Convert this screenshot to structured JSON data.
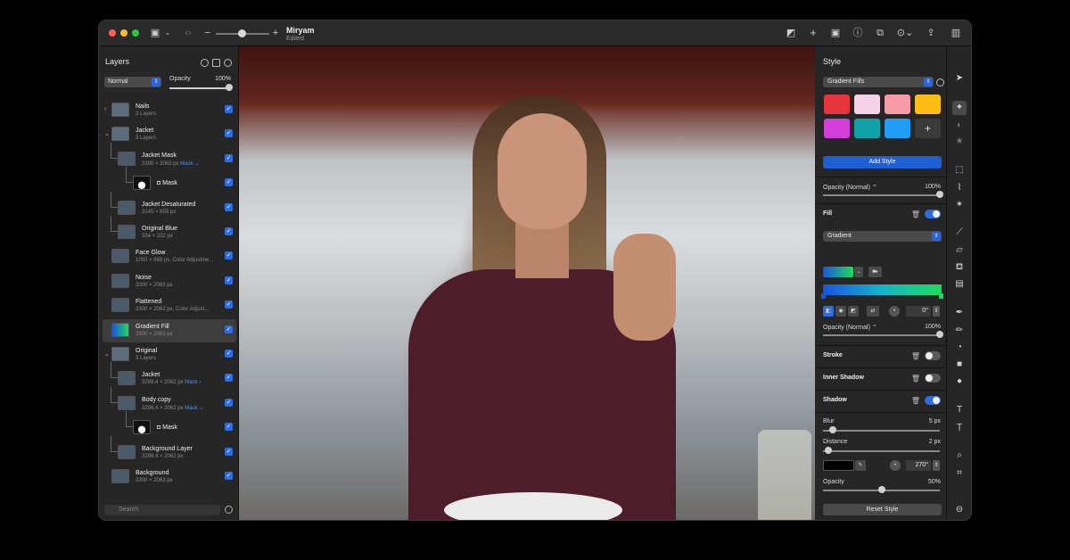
{
  "app": {
    "doc_title": "Miryam",
    "doc_status": "Edited"
  },
  "layers_panel": {
    "title": "Layers",
    "blend_mode": "Normal",
    "opacity_label": "Opacity",
    "opacity_value": "100%",
    "opacity_fraction": 1.0,
    "search_placeholder": "Search",
    "items": [
      {
        "name": "Nails",
        "detail": "3 Layers",
        "type": "group",
        "expanded": false
      },
      {
        "name": "Jacket",
        "detail": "3 Layers",
        "type": "group",
        "expanded": true
      },
      {
        "name": "Jacket Mask",
        "detail": "3300 × 2063 px",
        "mask": "Mask ⌄",
        "type": "image"
      },
      {
        "name": "Mask",
        "detail": "",
        "type": "mask"
      },
      {
        "name": "Jacket Desaturated",
        "detail": "3145 × 855 px",
        "type": "image"
      },
      {
        "name": "Original Blue",
        "detail": "334 × 232 px",
        "type": "image"
      },
      {
        "name": "Face Glow",
        "detail": "1050 × 688 px, Color Adjustme...",
        "type": "image"
      },
      {
        "name": "Noise",
        "detail": "3300 × 2063 px",
        "type": "image"
      },
      {
        "name": "Flattened",
        "detail": "3300 × 2062 px, Color Adjust...",
        "type": "image"
      },
      {
        "name": "Gradient Fill",
        "detail": "3300 × 2063 px",
        "type": "gradient",
        "selected": true
      },
      {
        "name": "Original",
        "detail": "3 Layers",
        "type": "group",
        "expanded": true
      },
      {
        "name": "Jacket",
        "detail": "3298.4 × 2062 px",
        "mask": "Mask ›",
        "type": "image"
      },
      {
        "name": "Body copy",
        "detail": "3298.4 × 2062 px",
        "mask": "Mask ⌄",
        "type": "image"
      },
      {
        "name": "Mask",
        "detail": "",
        "type": "mask"
      },
      {
        "name": "Background Layer",
        "detail": "3298.4 × 2062 px",
        "type": "image"
      },
      {
        "name": "Background",
        "detail": "3300 × 2063 px",
        "type": "image"
      }
    ]
  },
  "style_panel": {
    "title": "Style",
    "style_type": "Gradient Fills",
    "add_style_label": "Add Style",
    "reset_style_label": "Reset Style",
    "swatch_colors": [
      "#e8343c",
      "#f5d2e6",
      "#f59ca6",
      "#fdbd12",
      "#d43ed8",
      "#0fa2a8",
      "#1e9ef6"
    ],
    "add_swatch_symbol": "+",
    "opacity_top": {
      "label": "Opacity (Normal) ⌃",
      "value": "100%",
      "fraction": 1.0
    },
    "fill": {
      "label": "Fill",
      "enabled": true,
      "type": "Gradient",
      "angle": "0°"
    },
    "opacity_fill": {
      "label": "Opacity (Normal) ⌃",
      "value": "100%",
      "fraction": 1.0
    },
    "stroke": {
      "label": "Stroke",
      "enabled": false
    },
    "inner_shadow": {
      "label": "Inner Shadow",
      "enabled": false
    },
    "shadow": {
      "label": "Shadow",
      "enabled": true,
      "blur_label": "Blur",
      "blur_value": "5 px",
      "distance_label": "Distance",
      "distance_value": "2 px",
      "angle": "270°",
      "opacity_label": "Opacity",
      "opacity_value": "50%",
      "opacity_fraction": 0.5
    }
  },
  "colors": {
    "accent": "#2d6de0",
    "panel": "#262626",
    "gradient_start": "#1a55e0",
    "gradient_end": "#1edc5a"
  }
}
